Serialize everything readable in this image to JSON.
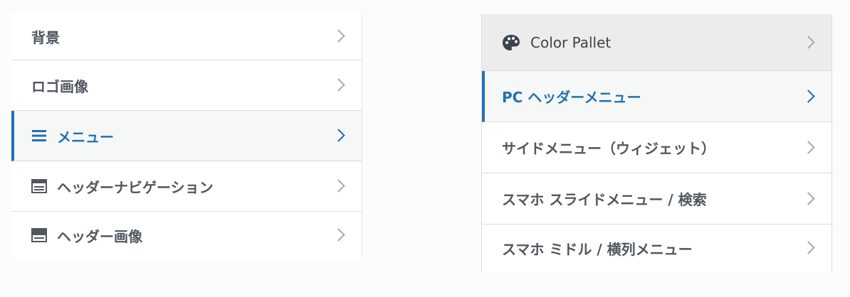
{
  "left_panel": {
    "items": [
      {
        "label": "背景",
        "icon": "",
        "active": false
      },
      {
        "label": "ロゴ画像",
        "icon": "",
        "active": false
      },
      {
        "label": "メニュー",
        "icon": "menu-icon",
        "active": true
      },
      {
        "label": "ヘッダーナビゲーション",
        "icon": "header-layout-icon",
        "active": false
      },
      {
        "label": "ヘッダー画像",
        "icon": "header-image-icon",
        "active": false
      }
    ]
  },
  "right_panel": {
    "items": [
      {
        "label": "Color Pallet",
        "icon": "palette-icon",
        "active": false
      },
      {
        "label": "PC ヘッダーメニュー",
        "icon": "",
        "active": true
      },
      {
        "label": "サイドメニュー（ウィジェット）",
        "icon": "",
        "active": false
      },
      {
        "label": "スマホ スライドメニュー / 検索",
        "icon": "",
        "active": false
      },
      {
        "label": "スマホ ミドル / 横列メニュー",
        "icon": "",
        "active": false
      }
    ]
  },
  "colors": {
    "accent": "#2271b1",
    "text": "#50575e",
    "chevron": "#a7aaad",
    "active_bg": "#f6f7f7",
    "highlight_bg": "#ececec"
  }
}
